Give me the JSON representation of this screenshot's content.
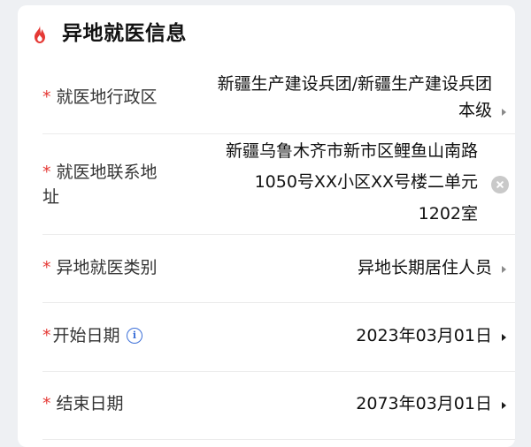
{
  "section": {
    "title": "异地就医信息",
    "icon": "flame-icon",
    "accent_color": "#e53935"
  },
  "fields": {
    "region": {
      "required_mark": "*",
      "label": "就医地行政区",
      "value_line1": "新疆生产建设兵团/新疆生产建设兵团",
      "value_line2": "本级"
    },
    "address": {
      "required_mark": "*",
      "label_line1": "就医地联系地",
      "label_line2": "址",
      "value_line1": "新疆乌鲁木齐市新市区鲤鱼山南路",
      "value_line2": "1050号XX小区XX号楼二单元",
      "value_line3": "1202室"
    },
    "category": {
      "required_mark": "*",
      "label": "异地就医类别",
      "value": "异地长期居住人员"
    },
    "start_date": {
      "required_mark": "*",
      "label": "开始日期",
      "info_glyph": "i",
      "value": "2023年03月01日"
    },
    "end_date": {
      "required_mark": "*",
      "label": "结束日期",
      "value": "2073年03月01日"
    }
  }
}
